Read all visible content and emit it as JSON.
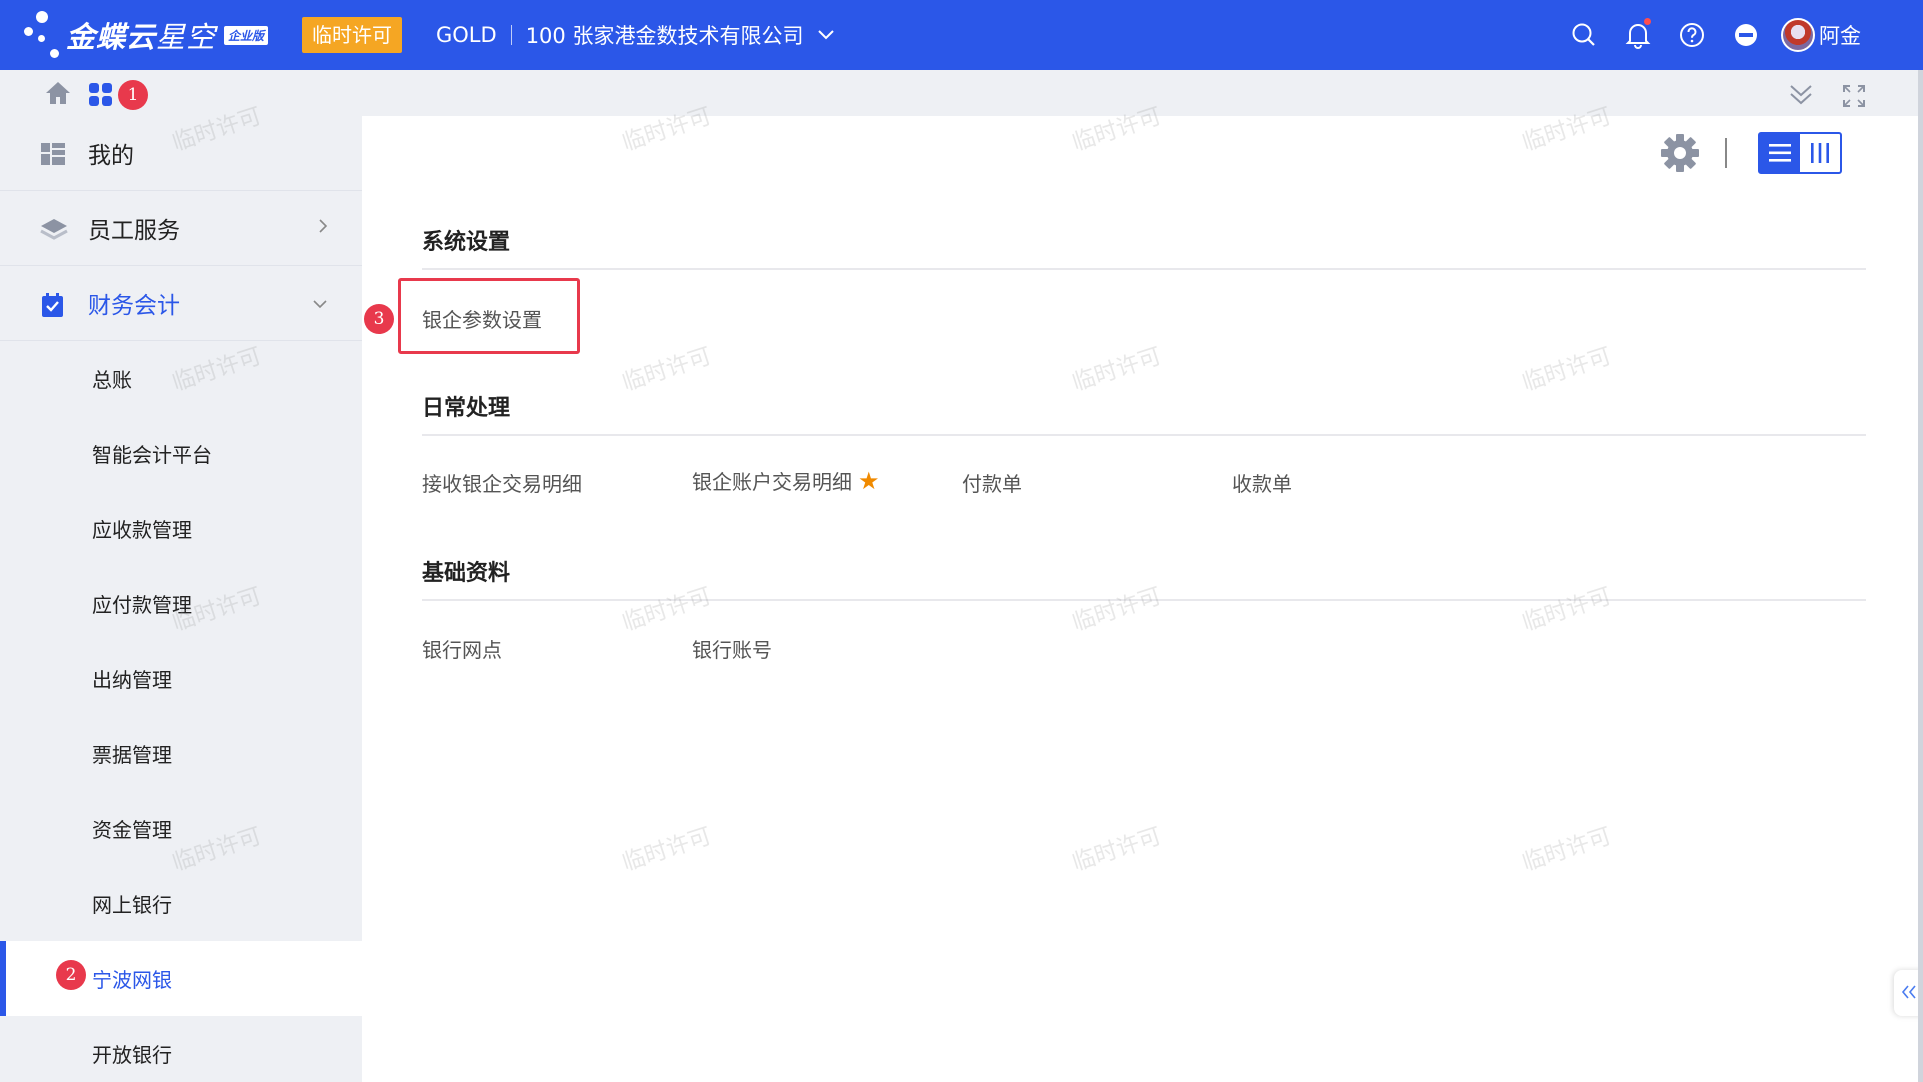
{
  "header": {
    "brand_main": "金蝶云",
    "brand_sub": "星空",
    "edition_badge": "企业版",
    "license_badge": "临时许可",
    "tenant_code": "GOLD",
    "tenant_name": "100 张家港金数技术有限公司",
    "username": "阿金"
  },
  "markers": {
    "apps": "1",
    "sidebar_selected": "2",
    "bank_param": "3"
  },
  "sidebar": {
    "top_items": [
      {
        "label": "我的"
      },
      {
        "label": "员工服务"
      },
      {
        "label": "财务会计"
      }
    ],
    "sub_items": [
      {
        "label": "总账"
      },
      {
        "label": "智能会计平台"
      },
      {
        "label": "应收款管理"
      },
      {
        "label": "应付款管理"
      },
      {
        "label": "出纳管理"
      },
      {
        "label": "票据管理"
      },
      {
        "label": "资金管理"
      },
      {
        "label": "网上银行"
      },
      {
        "label": "宁波网银"
      },
      {
        "label": "开放银行"
      }
    ]
  },
  "main": {
    "sections": [
      {
        "title": "系统设置",
        "items": [
          "银企参数设置"
        ]
      },
      {
        "title": "日常处理",
        "items": [
          "接收银企交易明细",
          "银企账户交易明细",
          "付款单",
          "收款单"
        ]
      },
      {
        "title": "基础资料",
        "items": [
          "银行网点",
          "银行账号"
        ]
      }
    ]
  },
  "watermark_text": "临时许可",
  "colors": {
    "primary": "#2b57e8",
    "marker": "#e8394c",
    "license": "#f5a623",
    "star": "#f08a00"
  }
}
